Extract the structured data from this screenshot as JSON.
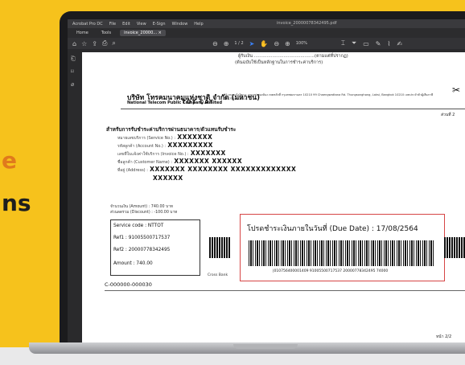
{
  "promo": {
    "line1": "e",
    "line2": "ns"
  },
  "app": {
    "menu": [
      "Acrobat Pro DC",
      "File",
      "Edit",
      "View",
      "E-Sign",
      "Window",
      "Help"
    ],
    "window_title": "invoice_20000078342495.pdf",
    "tabs": [
      {
        "label": "Home"
      },
      {
        "label": "Tools"
      },
      {
        "label": "invoice_20000... ×"
      }
    ],
    "toolbar": {
      "page_indicator": "1 / 2",
      "zoom": "100%"
    }
  },
  "document": {
    "header_line1": "ผู้รับเงิน ...........................................(ตามแต่ที่ปรากฏ)",
    "header_line2": "(ต้นฉบับใช้เป็นหลักฐานในการชำระค่าบริการ)",
    "company_th": "บริษัท โทรคมนาคมแห่งชาติ จำกัด (มหาชน)",
    "company_en": "National Telecom Public Company Limited",
    "logo_text": "TOT CAT",
    "address": "99 ถนนแจ้งวัฒนะ แขวงทุ่งสองห้อง เขตหลักสี่ กรุงเทพมหานคร 10210   99 Chaengwattana Rd. Thungsonghong, Laksi, Bangkok 10210  เลขประจำตัวผู้เสียภาษี 0107564000014",
    "part": "ส่วนที่ 2",
    "title": "สำหรับการรับชำระค่าบริการผ่านธนาคาร/ตัวแทนรับชำระ",
    "service_no_label": "หมายเลขบริการ (Service No.) :",
    "service_no": "XXXXXXX",
    "account_no_label": "รหัสลูกค้า (Account No.) :",
    "account_no": "XXXXXXXXX",
    "invoice_no_label": "เลขที่ใบแจ้งค่าใช้บริการ (Invoice No.) :",
    "invoice_no": "XXXXXXX",
    "customer_label": "ชื่อลูกค้า (Customer Name) :",
    "customer": "XXXXXXX XXXXXX",
    "address_label": "ที่อยู่ (Address) :",
    "address_value1": "XXXXXXX XXXXXXXX XXXXXXXXXXXXX",
    "address_value2": "XXXXXX",
    "amount_line": "จำนวนเงิน (Amount) : 740.00 บาท",
    "discount_line": "ส่วนลดรวม (Discount) : -100.00 บาท",
    "box": {
      "service_code": "Service code : NTTOT",
      "ref1": "Ref1 : 91005500717537",
      "ref2": "Ref2 : 20000778342495",
      "amount": "Amount : 740.00"
    },
    "cross_bank": "Cross Bank",
    "due_text": "โปรดชำระเงินภายในวันที่ (Due Date) : 17/08/2564",
    "barcode_number": "|010756400001409 91005500717537 20000778342495 74000",
    "id": "C-000000-000030",
    "page_number": "หน้า 2/2"
  }
}
